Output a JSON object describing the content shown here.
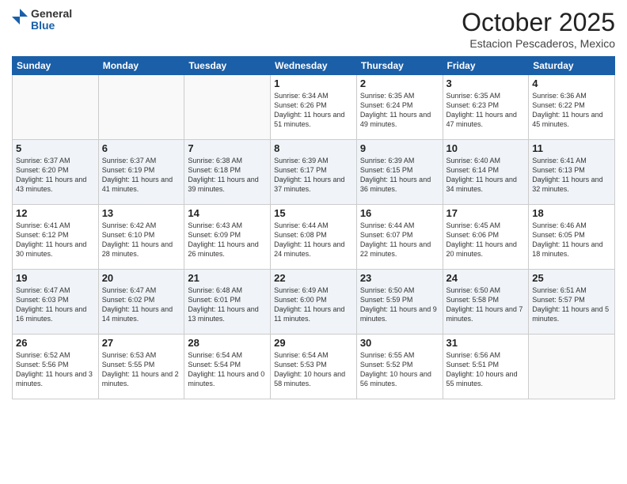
{
  "header": {
    "logo_general": "General",
    "logo_blue": "Blue",
    "month": "October 2025",
    "location": "Estacion Pescaderos, Mexico"
  },
  "days_of_week": [
    "Sunday",
    "Monday",
    "Tuesday",
    "Wednesday",
    "Thursday",
    "Friday",
    "Saturday"
  ],
  "weeks": [
    [
      {
        "day": "",
        "content": ""
      },
      {
        "day": "",
        "content": ""
      },
      {
        "day": "",
        "content": ""
      },
      {
        "day": "1",
        "content": "Sunrise: 6:34 AM\nSunset: 6:26 PM\nDaylight: 11 hours\nand 51 minutes."
      },
      {
        "day": "2",
        "content": "Sunrise: 6:35 AM\nSunset: 6:24 PM\nDaylight: 11 hours\nand 49 minutes."
      },
      {
        "day": "3",
        "content": "Sunrise: 6:35 AM\nSunset: 6:23 PM\nDaylight: 11 hours\nand 47 minutes."
      },
      {
        "day": "4",
        "content": "Sunrise: 6:36 AM\nSunset: 6:22 PM\nDaylight: 11 hours\nand 45 minutes."
      }
    ],
    [
      {
        "day": "5",
        "content": "Sunrise: 6:37 AM\nSunset: 6:20 PM\nDaylight: 11 hours\nand 43 minutes."
      },
      {
        "day": "6",
        "content": "Sunrise: 6:37 AM\nSunset: 6:19 PM\nDaylight: 11 hours\nand 41 minutes."
      },
      {
        "day": "7",
        "content": "Sunrise: 6:38 AM\nSunset: 6:18 PM\nDaylight: 11 hours\nand 39 minutes."
      },
      {
        "day": "8",
        "content": "Sunrise: 6:39 AM\nSunset: 6:17 PM\nDaylight: 11 hours\nand 37 minutes."
      },
      {
        "day": "9",
        "content": "Sunrise: 6:39 AM\nSunset: 6:15 PM\nDaylight: 11 hours\nand 36 minutes."
      },
      {
        "day": "10",
        "content": "Sunrise: 6:40 AM\nSunset: 6:14 PM\nDaylight: 11 hours\nand 34 minutes."
      },
      {
        "day": "11",
        "content": "Sunrise: 6:41 AM\nSunset: 6:13 PM\nDaylight: 11 hours\nand 32 minutes."
      }
    ],
    [
      {
        "day": "12",
        "content": "Sunrise: 6:41 AM\nSunset: 6:12 PM\nDaylight: 11 hours\nand 30 minutes."
      },
      {
        "day": "13",
        "content": "Sunrise: 6:42 AM\nSunset: 6:10 PM\nDaylight: 11 hours\nand 28 minutes."
      },
      {
        "day": "14",
        "content": "Sunrise: 6:43 AM\nSunset: 6:09 PM\nDaylight: 11 hours\nand 26 minutes."
      },
      {
        "day": "15",
        "content": "Sunrise: 6:44 AM\nSunset: 6:08 PM\nDaylight: 11 hours\nand 24 minutes."
      },
      {
        "day": "16",
        "content": "Sunrise: 6:44 AM\nSunset: 6:07 PM\nDaylight: 11 hours\nand 22 minutes."
      },
      {
        "day": "17",
        "content": "Sunrise: 6:45 AM\nSunset: 6:06 PM\nDaylight: 11 hours\nand 20 minutes."
      },
      {
        "day": "18",
        "content": "Sunrise: 6:46 AM\nSunset: 6:05 PM\nDaylight: 11 hours\nand 18 minutes."
      }
    ],
    [
      {
        "day": "19",
        "content": "Sunrise: 6:47 AM\nSunset: 6:03 PM\nDaylight: 11 hours\nand 16 minutes."
      },
      {
        "day": "20",
        "content": "Sunrise: 6:47 AM\nSunset: 6:02 PM\nDaylight: 11 hours\nand 14 minutes."
      },
      {
        "day": "21",
        "content": "Sunrise: 6:48 AM\nSunset: 6:01 PM\nDaylight: 11 hours\nand 13 minutes."
      },
      {
        "day": "22",
        "content": "Sunrise: 6:49 AM\nSunset: 6:00 PM\nDaylight: 11 hours\nand 11 minutes."
      },
      {
        "day": "23",
        "content": "Sunrise: 6:50 AM\nSunset: 5:59 PM\nDaylight: 11 hours\nand 9 minutes."
      },
      {
        "day": "24",
        "content": "Sunrise: 6:50 AM\nSunset: 5:58 PM\nDaylight: 11 hours\nand 7 minutes."
      },
      {
        "day": "25",
        "content": "Sunrise: 6:51 AM\nSunset: 5:57 PM\nDaylight: 11 hours\nand 5 minutes."
      }
    ],
    [
      {
        "day": "26",
        "content": "Sunrise: 6:52 AM\nSunset: 5:56 PM\nDaylight: 11 hours\nand 3 minutes."
      },
      {
        "day": "27",
        "content": "Sunrise: 6:53 AM\nSunset: 5:55 PM\nDaylight: 11 hours\nand 2 minutes."
      },
      {
        "day": "28",
        "content": "Sunrise: 6:54 AM\nSunset: 5:54 PM\nDaylight: 11 hours\nand 0 minutes."
      },
      {
        "day": "29",
        "content": "Sunrise: 6:54 AM\nSunset: 5:53 PM\nDaylight: 10 hours\nand 58 minutes."
      },
      {
        "day": "30",
        "content": "Sunrise: 6:55 AM\nSunset: 5:52 PM\nDaylight: 10 hours\nand 56 minutes."
      },
      {
        "day": "31",
        "content": "Sunrise: 6:56 AM\nSunset: 5:51 PM\nDaylight: 10 hours\nand 55 minutes."
      },
      {
        "day": "",
        "content": ""
      }
    ]
  ]
}
